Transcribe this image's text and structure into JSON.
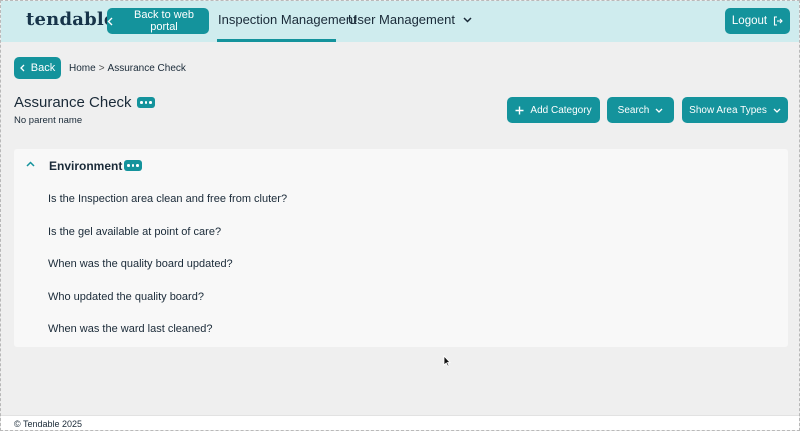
{
  "header": {
    "logo": "tendable",
    "back_to_portal": "Back to web portal",
    "nav_inspection": "Inspection Management",
    "nav_user": "User Management",
    "logout": "Logout"
  },
  "breadcrumb": {
    "back": "Back",
    "home": "Home",
    "separator": ">",
    "current": "Assurance Check"
  },
  "page": {
    "title": "Assurance Check",
    "subtitle": "No parent name",
    "add_category": "Add Category",
    "search": "Search",
    "show_area_types": "Show Area Types"
  },
  "category": {
    "name": "Environment",
    "questions": [
      "Is the Inspection area clean and free from cluter?",
      "Is the gel available at point of care?",
      "When was the quality board updated?",
      "Who updated the quality board?",
      "When was the ward last cleaned?"
    ]
  },
  "footer": {
    "copyright": "© Tendable 2025"
  },
  "colors": {
    "accent": "#14939c",
    "header_bg": "#cfecee",
    "text": "#1a2a38"
  }
}
